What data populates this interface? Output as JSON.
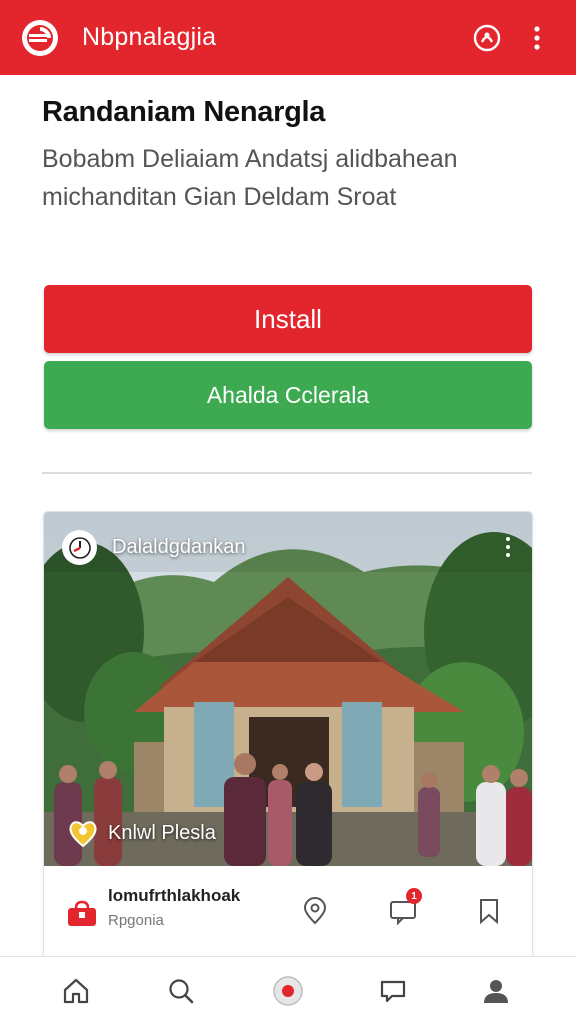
{
  "app": {
    "title": "Nbpnalagjia",
    "brand_color": "#e3262e",
    "logo_icon": "brand-logo-icon",
    "actions": [
      "profile-icon",
      "more-vertical-icon"
    ]
  },
  "header": {
    "title": "Randaniam Nenargla",
    "description": "Bobabm Deliaiam Andatsj alidbahean michanditan Gian Deldam Sroat"
  },
  "buttons": {
    "install_label": "Install",
    "secondary_label": "Ahalda Cclerala",
    "install_color": "#e3262e",
    "secondary_color": "#3daa52"
  },
  "post": {
    "channel_name": "Dalaldgdankan",
    "channel_icon": "clock-icon",
    "location": "Knlwl Plesla",
    "location_icon": "location-heart-icon",
    "shop_name": "lomufrthlakhoak",
    "shop_sub": "Rpgonia",
    "comment_count": "1",
    "icons": [
      "shop-bag-icon",
      "eye-icon",
      "comment-icon",
      "bookmark-icon"
    ]
  },
  "bottom_nav": {
    "items": [
      "home-icon",
      "search-icon",
      "record-icon",
      "chat-icon",
      "profile-icon"
    ]
  }
}
